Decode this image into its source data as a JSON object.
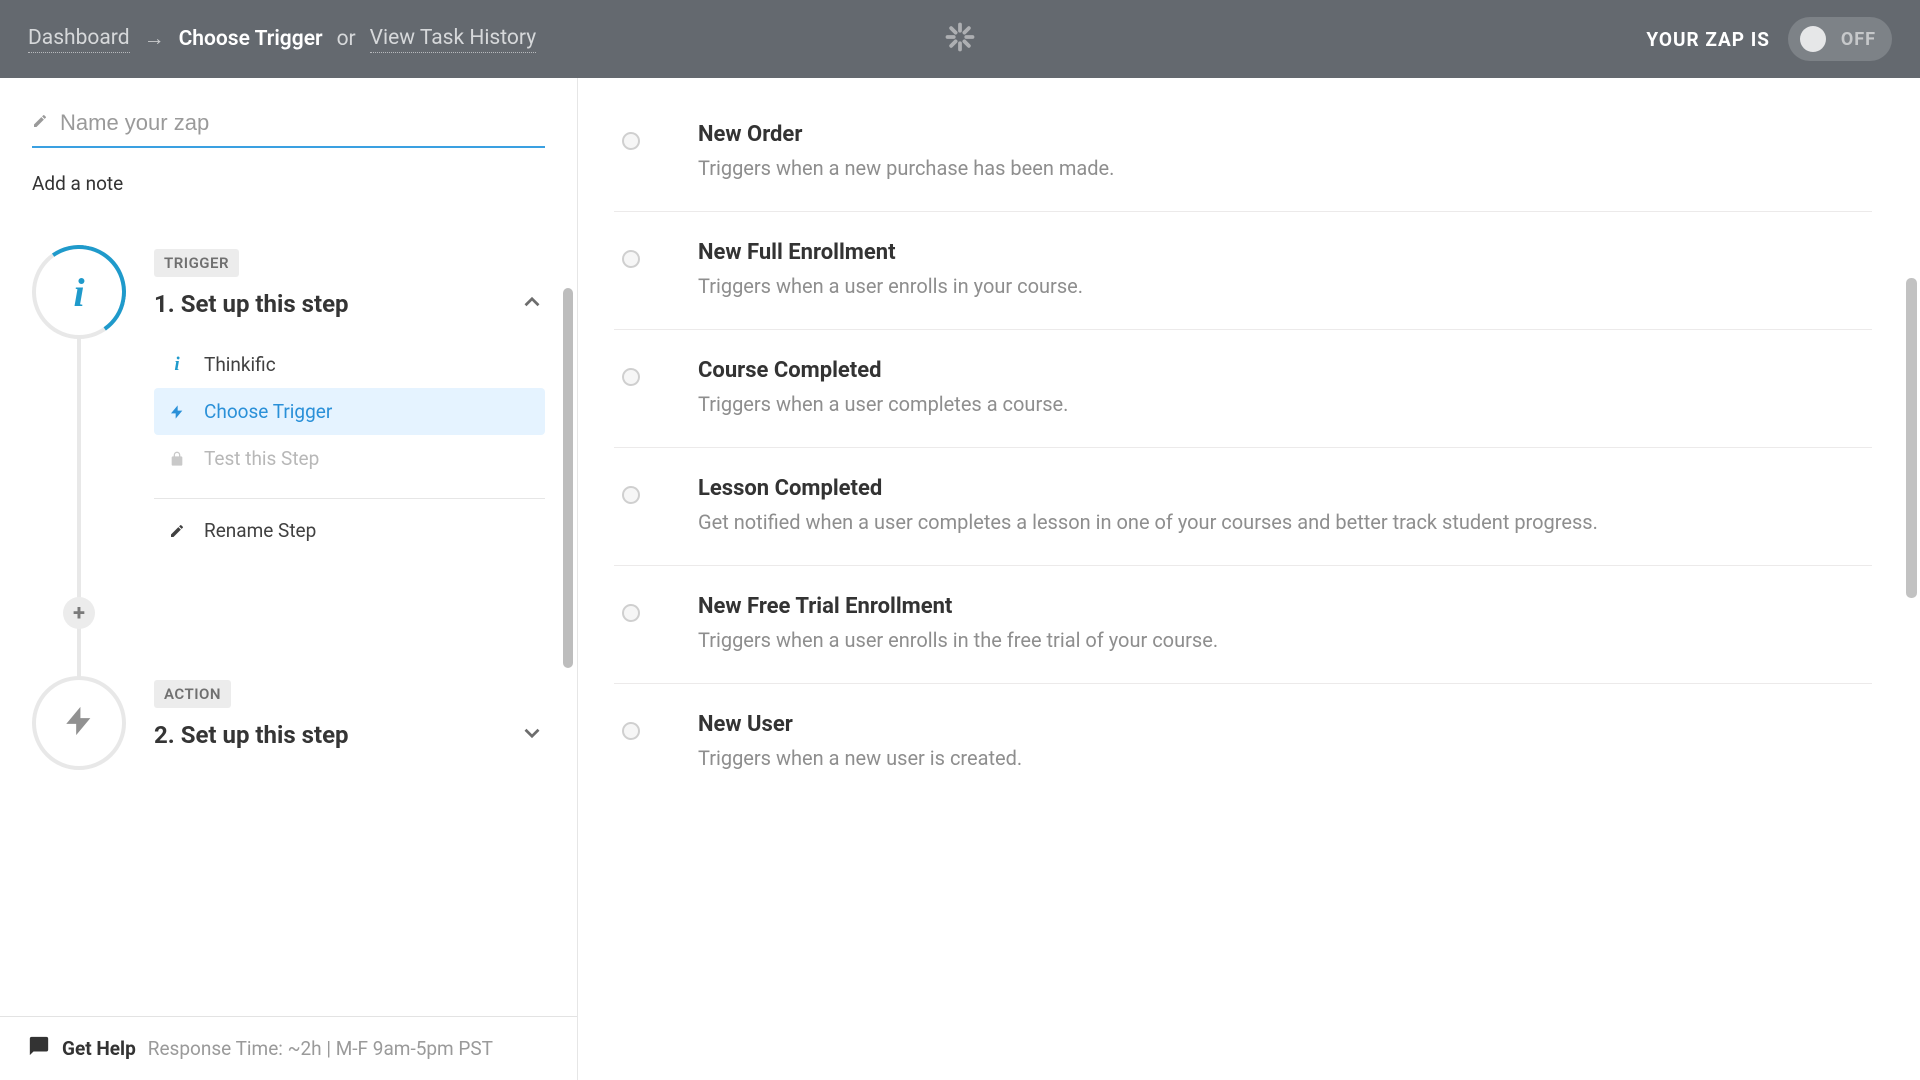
{
  "topbar": {
    "dashboard": "Dashboard",
    "arrow": "→",
    "current": "Choose Trigger",
    "or": "or",
    "history": "View Task History",
    "status_label": "YOUR ZAP IS",
    "toggle_text": "OFF"
  },
  "sidebar": {
    "name_placeholder": "Name your zap",
    "add_note": "Add a note",
    "step1": {
      "tag": "TRIGGER",
      "title": "1. Set up this step",
      "sub_app": "Thinkific",
      "sub_choose": "Choose Trigger",
      "sub_test": "Test this Step",
      "rename": "Rename Step"
    },
    "step2": {
      "tag": "ACTION",
      "title": "2. Set up this step"
    }
  },
  "help": {
    "label": "Get Help",
    "meta": "Response Time: ~2h | M-F 9am-5pm PST"
  },
  "triggers": [
    {
      "title": "New Order",
      "desc": "Triggers when a new purchase has been made."
    },
    {
      "title": "New Full Enrollment",
      "desc": "Triggers when a user enrolls in your course."
    },
    {
      "title": "Course Completed",
      "desc": "Triggers when a user completes a course."
    },
    {
      "title": "Lesson Completed",
      "desc": "Get notified when a user completes a lesson in one of your courses and better track student progress."
    },
    {
      "title": "New Free Trial Enrollment",
      "desc": "Triggers when a user enrolls in the free trial of your course."
    },
    {
      "title": "New User",
      "desc": "Triggers when a new user is created."
    }
  ]
}
